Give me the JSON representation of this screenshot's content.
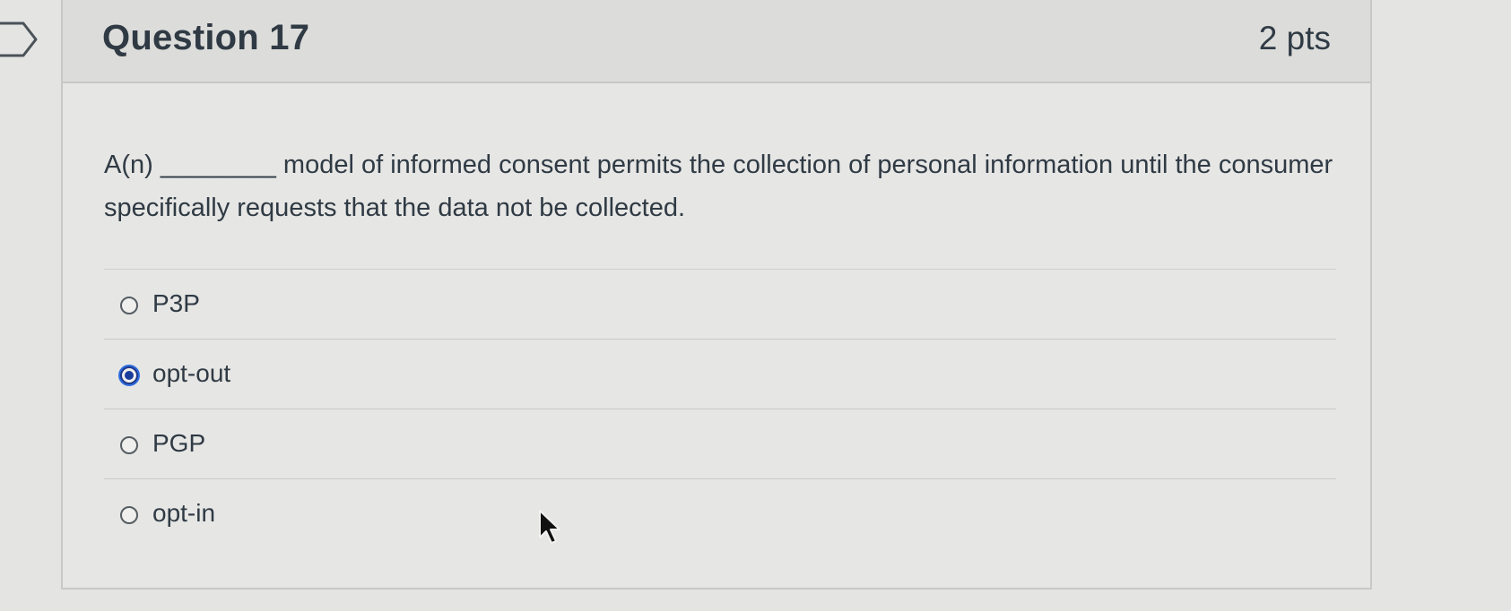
{
  "question": {
    "title": "Question 17",
    "points": "2 pts",
    "text": "A(n) ________ model of informed consent permits the collection of personal information until the consumer specifically requests that the data not be collected."
  },
  "answers": [
    {
      "label": "P3P",
      "selected": false
    },
    {
      "label": "opt-out",
      "selected": true
    },
    {
      "label": "PGP",
      "selected": false
    },
    {
      "label": "opt-in",
      "selected": false
    }
  ],
  "icons": {
    "flag": "flag-icon",
    "cursor": "mouse-pointer-icon"
  },
  "colors": {
    "selected_radio": "#1a3d9c",
    "text": "#2f3a44",
    "background": "#e4e4e2"
  }
}
